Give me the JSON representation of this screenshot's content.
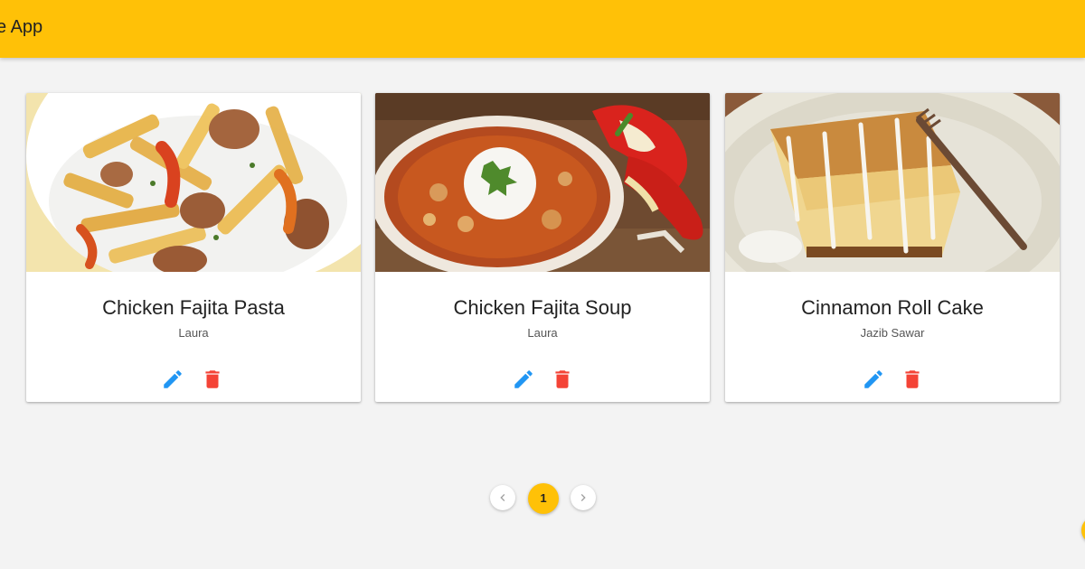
{
  "app": {
    "title": "e App",
    "accent_color": "#ffc107"
  },
  "recipes": [
    {
      "title": "Chicken Fajita Pasta",
      "author": "Laura",
      "image_icon": "pasta-image"
    },
    {
      "title": "Chicken Fajita Soup",
      "author": "Laura",
      "image_icon": "soup-image"
    },
    {
      "title": "Cinnamon Roll Cake",
      "author": "Jazib Sawar",
      "image_icon": "cake-image"
    }
  ],
  "actions": {
    "edit_icon": "pencil-icon",
    "edit_color": "#2196f3",
    "delete_icon": "trash-icon",
    "delete_color": "#f44336"
  },
  "pagination": {
    "current_page": "1",
    "prev_icon": "chevron-left-icon",
    "next_icon": "chevron-right-icon"
  }
}
